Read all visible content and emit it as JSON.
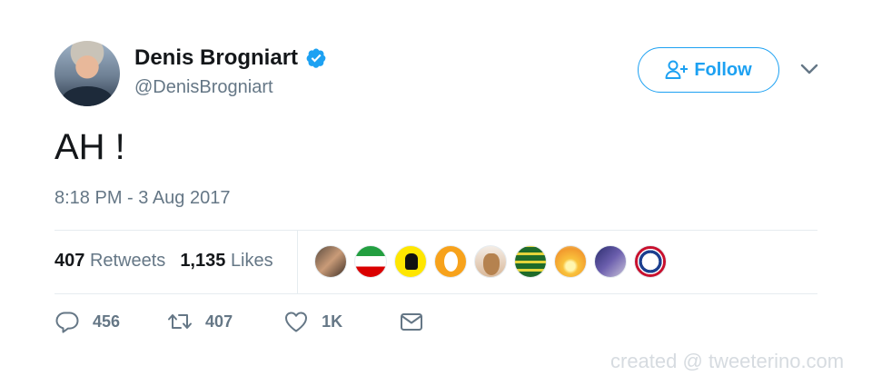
{
  "user": {
    "name": "Denis Brogniart",
    "handle": "@DenisBrogniart",
    "verified": true
  },
  "follow_button": {
    "label": "Follow"
  },
  "tweet": {
    "text": "AH !",
    "timestamp": "8:18 PM - 3 Aug 2017"
  },
  "stats": {
    "retweets_count": "407",
    "retweets_label": "Retweets",
    "likes_count": "1,135",
    "likes_label": "Likes"
  },
  "actions": {
    "reply_count": "456",
    "retweet_count": "407",
    "like_count": "1K"
  },
  "watermark": "created @ tweeterino.com",
  "colors": {
    "accent": "#1da1f2",
    "text_primary": "#14171a",
    "text_secondary": "#657786",
    "divider": "#e6ecf0"
  },
  "icons": [
    "verified-badge-icon",
    "add-user-icon",
    "chevron-down-icon",
    "reply-icon",
    "retweet-icon",
    "heart-icon",
    "direct-message-icon"
  ]
}
